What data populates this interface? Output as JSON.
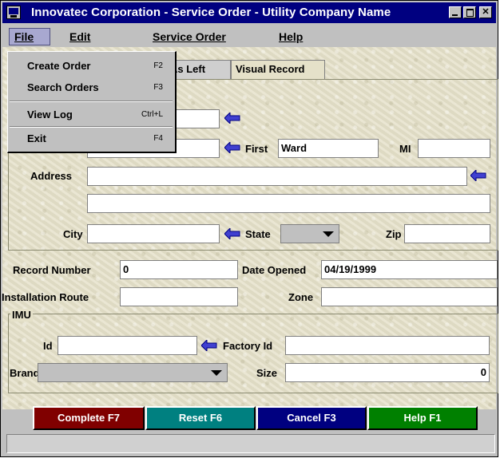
{
  "window": {
    "title": "Innovatec Corporation - Service Order - Utility Company Name"
  },
  "menubar": {
    "file": {
      "label": "File"
    },
    "edit": {
      "label": "Edit"
    },
    "service_order": {
      "label": "Service Order"
    },
    "help": {
      "label": "Help"
    }
  },
  "file_menu": {
    "items": [
      {
        "label": "Create Order",
        "shortcut": "F2"
      },
      {
        "label": "Search Orders",
        "shortcut": "F3"
      },
      {
        "label": "View Log",
        "shortcut": "Ctrl+L"
      },
      {
        "label": "Exit",
        "shortcut": "F4"
      }
    ]
  },
  "tabs": [
    {
      "label": "As Left"
    },
    {
      "label": "Visual Record"
    }
  ],
  "customer": {
    "first_label": "First",
    "first_value": "Ward",
    "mi_label": "MI",
    "mi_value": "",
    "address_label": "Address",
    "address_line1": "",
    "address_line2": "",
    "city_label": "City",
    "city_value": "",
    "state_label": "State",
    "state_value": "",
    "zip_label": "Zip",
    "zip_value": ""
  },
  "record": {
    "record_number_label": "Record Number",
    "record_number_value": "0",
    "date_opened_label": "Date Opened",
    "date_opened_value": "04/19/1999",
    "installation_route_label": "Installation Route",
    "installation_route_value": "",
    "zone_label": "Zone",
    "zone_value": ""
  },
  "imu": {
    "group_label": "IMU",
    "id_label": "Id",
    "id_value": "",
    "factory_id_label": "Factory Id",
    "factory_id_value": "",
    "brand_label": "Brand",
    "brand_value": "",
    "size_label": "Size",
    "size_value": "0"
  },
  "buttons": {
    "complete": {
      "label": "Complete F7",
      "color": "#800000"
    },
    "reset": {
      "label": "Reset F6",
      "color": "#008080"
    },
    "cancel": {
      "label": "Cancel F3",
      "color": "#000080"
    },
    "help": {
      "label": "Help F1",
      "color": "#008000"
    }
  },
  "status": {
    "text": ""
  },
  "icons": {
    "lookup": "left-arrow-icon",
    "dropdown": "triangle-down-icon"
  }
}
